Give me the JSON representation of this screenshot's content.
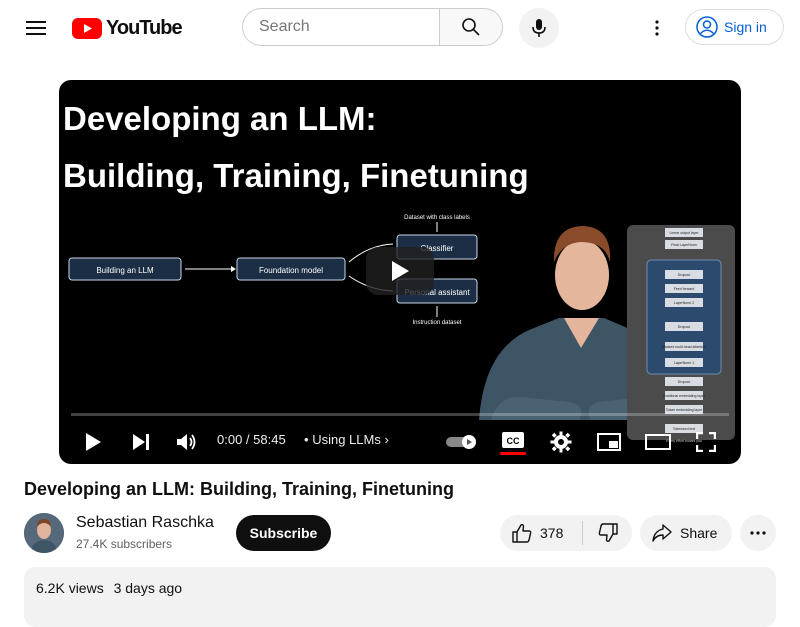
{
  "header": {
    "logo_text": "YouTube",
    "search_placeholder": "Search",
    "signin_label": "Sign in",
    "brand_color": "#ff0000",
    "link_color": "#065fd4"
  },
  "player": {
    "thumbnail": {
      "title_line1": "Developing an LLM:",
      "title_line2": "Building, Training, Finetuning",
      "diagram": {
        "box1": "Building an LLM",
        "box2": "Foundation model",
        "box3": "Classifier",
        "box4": "Personal assistant",
        "label_top": "Dataset with class labels",
        "label_bottom": "Instruction dataset"
      },
      "arch_labels": [
        "Linear output layer",
        "Final LayerNorm",
        "Dropout",
        "Feed forward",
        "LayerNorm 2",
        "Dropout",
        "Masked multi-head attention",
        "LayerNorm 1",
        "Dropout",
        "Positional embedding layer",
        "Token embedding layer",
        "Tokenized text",
        "Every effort moves you"
      ]
    },
    "time": "0:00 / 58:45",
    "chapter_separator": "•",
    "chapter": "Using LLMs",
    "cc_label": "CC",
    "progress_fraction": 0.0
  },
  "video": {
    "title": "Developing an LLM: Building, Training, Finetuning",
    "channel_name": "Sebastian Raschka",
    "subscribers": "27.4K subscribers",
    "subscribe_label": "Subscribe",
    "likes": "378",
    "share_label": "Share",
    "views": "6.2K views",
    "uploaded": "3 days ago"
  }
}
